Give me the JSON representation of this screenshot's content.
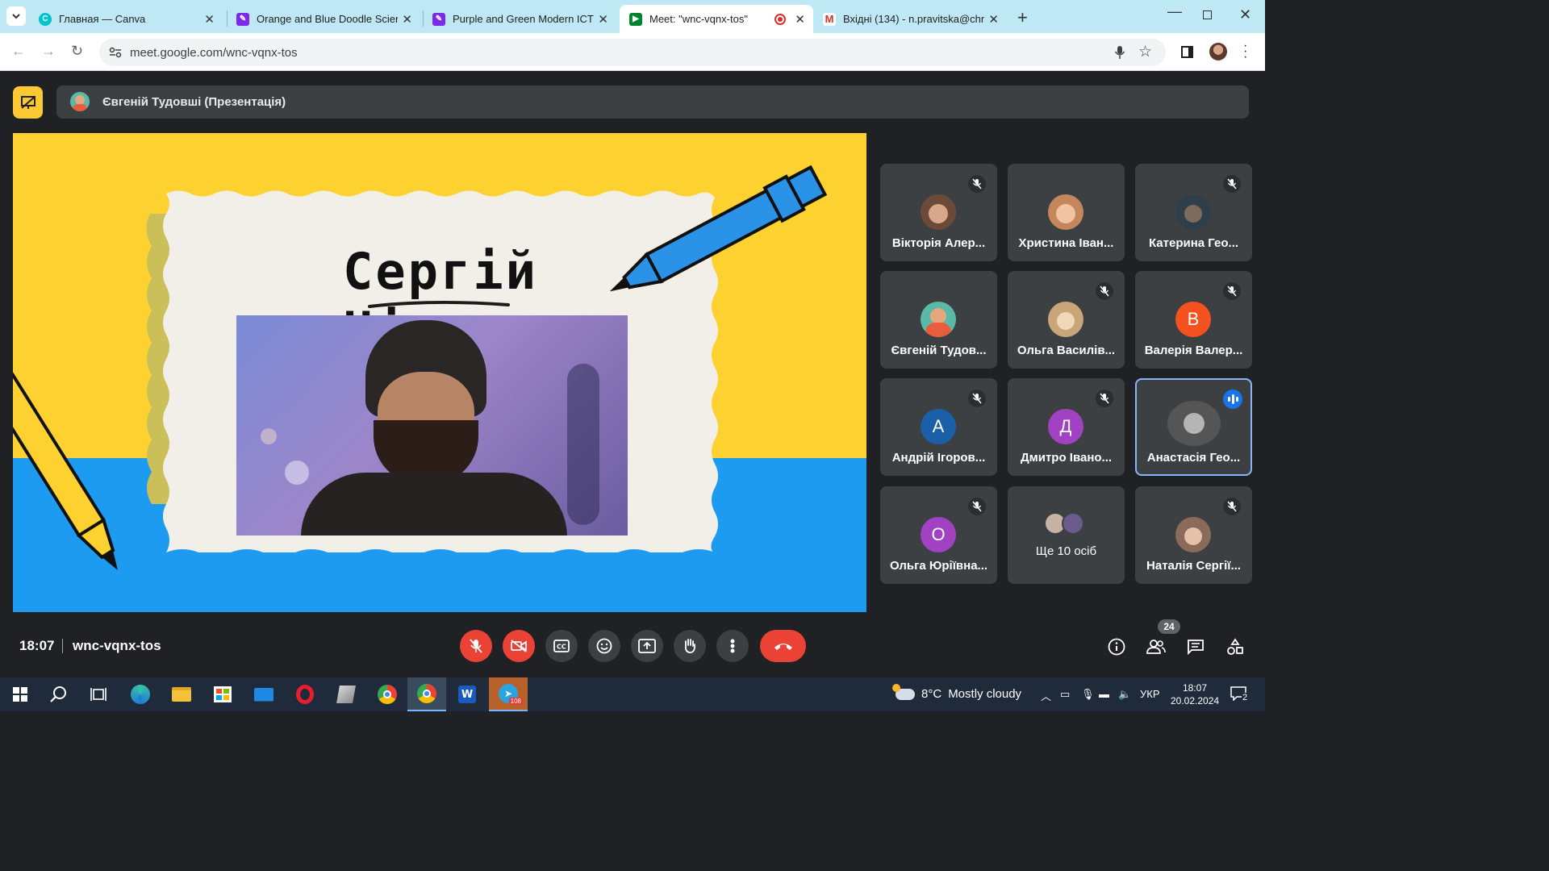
{
  "browser": {
    "tabs": [
      {
        "title": "Главная — Canva",
        "favicon": "canva-icon"
      },
      {
        "title": "Orange and Blue Doodle Scienc",
        "favicon": "canva-design-icon"
      },
      {
        "title": "Purple and Green Modern ICT C",
        "favicon": "canva-design-icon"
      },
      {
        "title": "Meet: \"wnc-vqnx-tos\"",
        "favicon": "google-meet-icon",
        "active": true,
        "recording": true
      },
      {
        "title": "Вхідні (134) - n.pravitska@chnu",
        "favicon": "gmail-icon"
      }
    ],
    "url": "meet.google.com/wnc-vqnx-tos"
  },
  "meet": {
    "presenter_label": "Євгеній Тудовші (Презентація)",
    "slide": {
      "title": "Сергій Нігоян",
      "colors": {
        "yellow": "#fdd230",
        "blue": "#1d9bf0",
        "paper": "#f1efe7"
      }
    },
    "participants": [
      {
        "name": "Вікторія Алер...",
        "muted": true,
        "avatar": "photo",
        "color": "#6b4a3a"
      },
      {
        "name": "Христина Іван...",
        "muted": false,
        "avatar": "photo",
        "color": "#c4865a"
      },
      {
        "name": "Катерина Гео...",
        "muted": true,
        "avatar": "photo",
        "color": "#2e3f4a"
      },
      {
        "name": "Євгеній Тудов...",
        "muted": false,
        "avatar": "cartoon",
        "color": "#5bb9a8"
      },
      {
        "name": "Ольга Василів...",
        "muted": true,
        "avatar": "photo",
        "color": "#c9a57a"
      },
      {
        "name": "Валерія Валер...",
        "muted": true,
        "avatar": "letter",
        "letter": "В",
        "color": "#f4511e"
      },
      {
        "name": "Андрій Ігоров...",
        "muted": true,
        "avatar": "letter",
        "letter": "А",
        "color": "#1a5fa8"
      },
      {
        "name": "Дмитро Івано...",
        "muted": true,
        "avatar": "letter",
        "letter": "Д",
        "color": "#a142c2"
      },
      {
        "name": "Анастасія Гео...",
        "muted": false,
        "speaking": true,
        "avatar": "photo",
        "color": "#555555"
      },
      {
        "name": "Ольга Юріївна...",
        "muted": true,
        "avatar": "letter",
        "letter": "О",
        "color": "#a142c2"
      },
      {
        "name": "Ще 10 осіб",
        "muted": false,
        "avatar": "group",
        "color": "#777777"
      },
      {
        "name": "Наталія Сергії...",
        "muted": true,
        "avatar": "photo",
        "color": "#8a6a58"
      }
    ],
    "time": "18:07",
    "meeting_code": "wnc-vqnx-tos",
    "participants_count": "24",
    "controls": [
      "mic-off-icon",
      "camera-off-icon",
      "captions-icon",
      "emoji-icon",
      "present-icon",
      "raise-hand-icon",
      "more-icon",
      "hangup-icon"
    ]
  },
  "taskbar": {
    "weather_temp": "8°C",
    "weather_desc": "Mostly cloudy",
    "language": "УКР",
    "time": "18:07",
    "date": "20.02.2024",
    "notifications": "2",
    "telegram_badge": "108"
  }
}
